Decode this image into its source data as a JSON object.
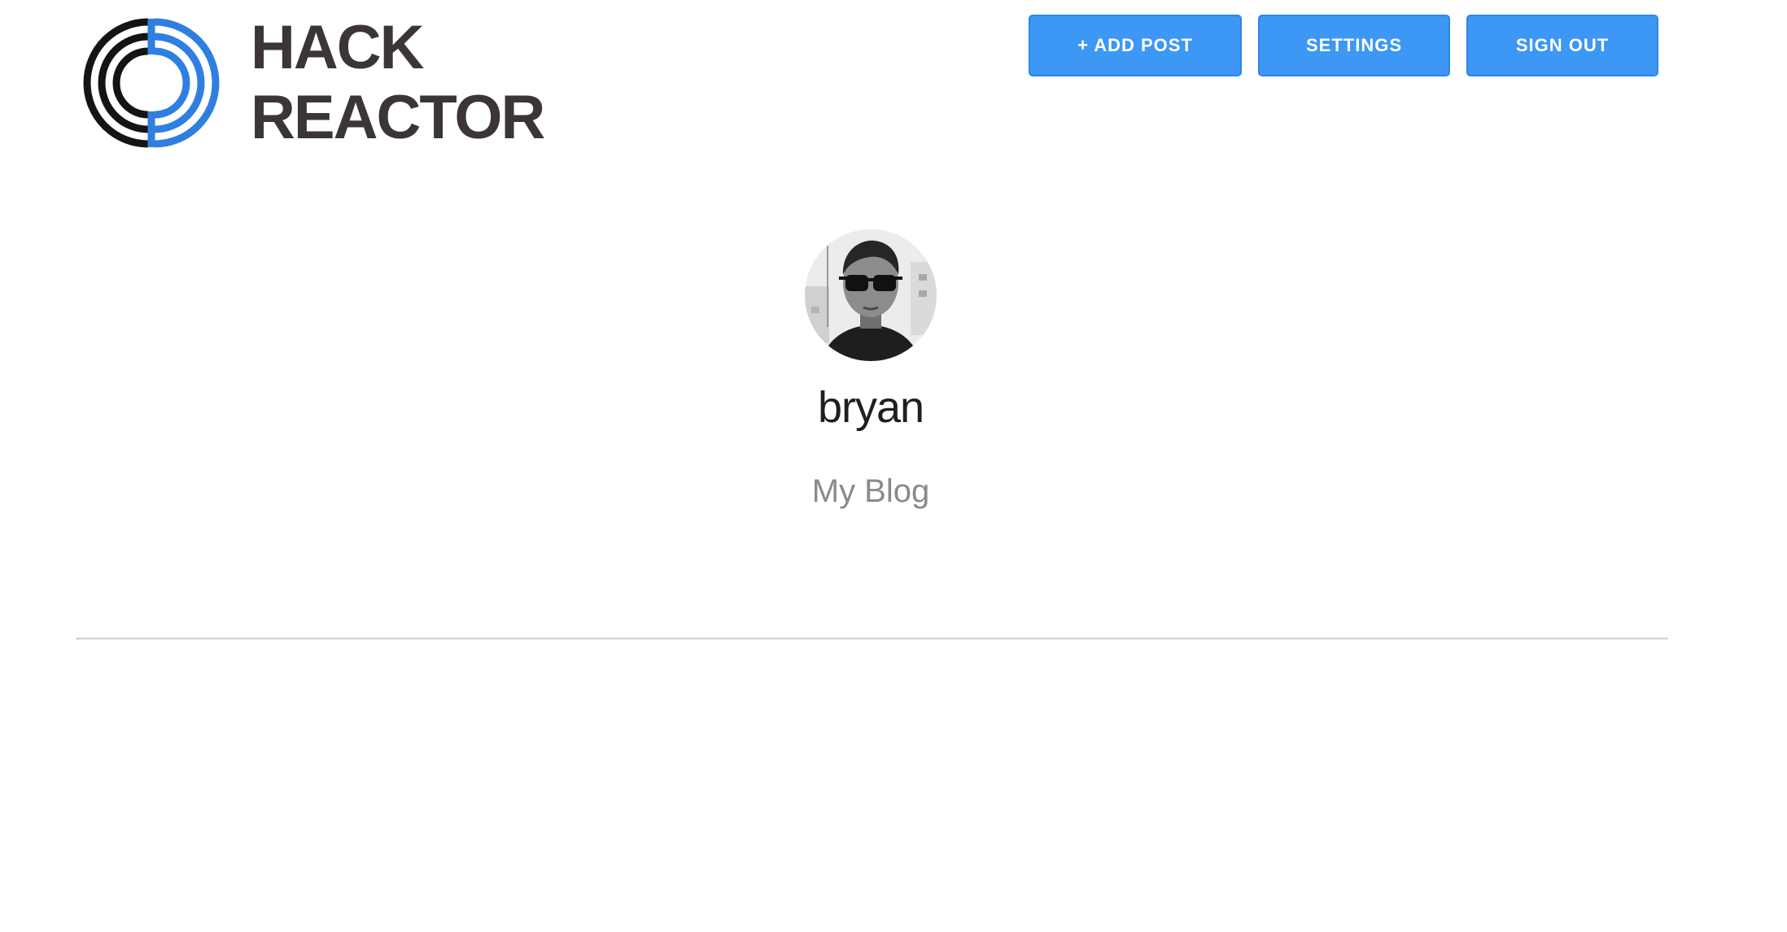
{
  "header": {
    "logo": {
      "line1": "HACK",
      "line2": "REACTOR",
      "icon": "hack-reactor-logo-icon"
    },
    "buttons": {
      "add_post": "+ ADD POST",
      "settings": "SETTINGS",
      "sign_out": "SIGN OUT"
    }
  },
  "profile": {
    "username": "bryan",
    "blog_title": "My Blog",
    "avatar_icon": "avatar-photo"
  },
  "colors": {
    "button": "#3d97f5",
    "logo_blue": "#2f7fe0",
    "logo_dark": "#141414",
    "divider": "#d6d6d6"
  }
}
